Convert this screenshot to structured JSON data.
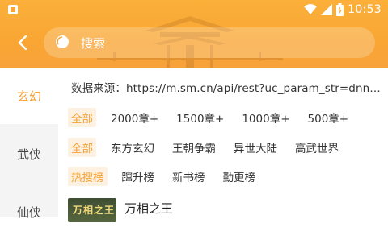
{
  "status_bar": {
    "time": "10:53",
    "icons": [
      "app-notification-icon",
      "wifi-icon",
      "signal-icon",
      "battery-charging-icon"
    ]
  },
  "header": {
    "back_icon": "chevron-left-icon",
    "search_placeholder": "搜索",
    "colors": {
      "accent": "#f6a233",
      "header_bg": "#f9a634"
    }
  },
  "sidebar": {
    "items": [
      {
        "label": "玄幻",
        "active": true
      },
      {
        "label": "武侠",
        "active": false
      },
      {
        "label": "仙侠",
        "active": false
      }
    ]
  },
  "main": {
    "source": "数据来源：https://m.sm.cn/api/rest?uc_param_str=dnntn...",
    "filters": {
      "length": [
        "全部",
        "2000章+",
        "1500章+",
        "1000章+",
        "500章+"
      ],
      "genre": [
        "全部",
        "东方玄幻",
        "王朝争霸",
        "异世大陆",
        "高武世界"
      ],
      "ranking": [
        "热搜榜",
        "蹿升榜",
        "新书榜",
        "勤更榜"
      ]
    },
    "books": [
      {
        "title": "万相之王",
        "cover_text": "万相之王"
      }
    ]
  }
}
